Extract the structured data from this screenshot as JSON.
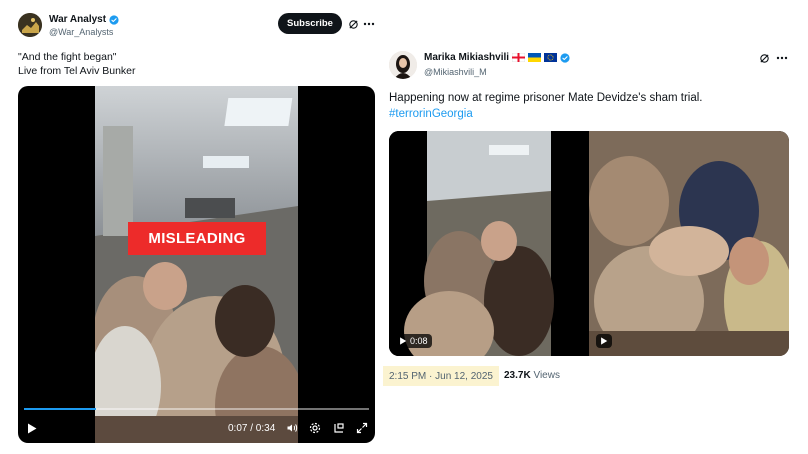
{
  "left_post": {
    "author_name": "War Analyst",
    "handle": "@War_Analysts",
    "subscribe_label": "Subscribe",
    "text_line1": "\"And the fight began\"",
    "text_line2": "Live from Tel Aviv Bunker",
    "video": {
      "label": "MISLEADING",
      "timecode": "0:07 / 0:34",
      "progress": 0.21
    }
  },
  "right_post": {
    "author_name": "Marika Mikiashvili",
    "handle": "@Mikiashvili_M",
    "text_line1": "Happening now at regime prisoner Mate Devidze's sham trial.",
    "hashtag": "#terrorinGeorgia",
    "video_duration": "0:08",
    "timestamp": "2:15 PM · Jun 12, 2025",
    "views_count": "23.7K",
    "views_label": "Views"
  },
  "colors": {
    "verified_blue": "#1d9bf0",
    "misleading_red": "#ed2b2a",
    "timestamp_highlight": "#fbf3d0"
  },
  "icons": [
    "verified-icon",
    "grok-icon",
    "more-icon",
    "play-icon",
    "volume-icon",
    "settings-icon",
    "pip-icon",
    "fullscreen-icon",
    "flag-georgia-icon",
    "flag-ukraine-icon",
    "flag-eu-icon"
  ]
}
